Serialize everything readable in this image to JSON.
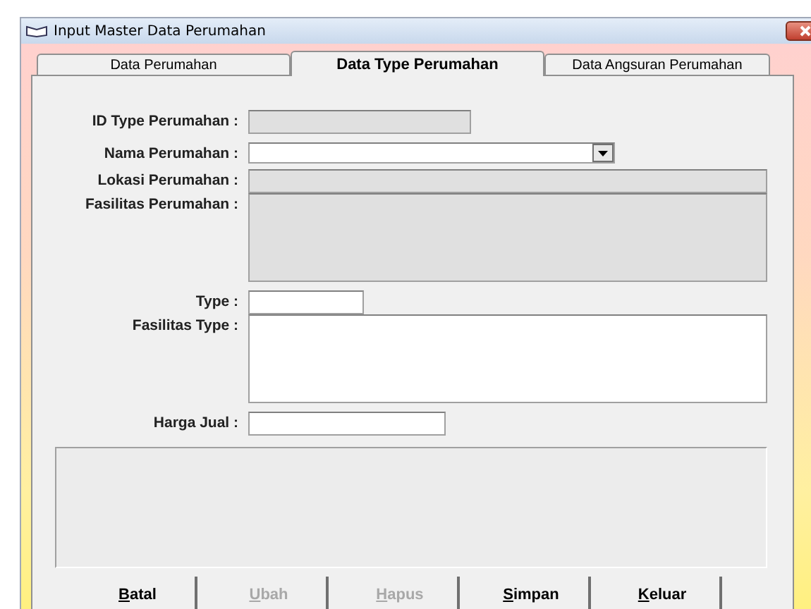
{
  "window": {
    "title": "Input Master Data Perumahan"
  },
  "tabs": [
    {
      "label": "Data Perumahan",
      "selected": false
    },
    {
      "label": "Data Type Perumahan",
      "selected": true
    },
    {
      "label": "Data Angsuran Perumahan",
      "selected": false
    }
  ],
  "fields": [
    {
      "label": "ID Type Perumahan :",
      "kind": "text",
      "disabled": true
    },
    {
      "label": "Nama Perumahan :",
      "kind": "combo",
      "disabled": false
    },
    {
      "label": "Lokasi Perumahan :",
      "kind": "text",
      "disabled": true
    },
    {
      "label": "Fasilitas Perumahan :",
      "kind": "textarea",
      "disabled": true
    },
    {
      "label": "Type :",
      "kind": "text",
      "disabled": false
    },
    {
      "label": "Fasilitas Type :",
      "kind": "textarea",
      "disabled": false
    },
    {
      "label": "Harga Jual :",
      "kind": "text",
      "disabled": false
    }
  ],
  "buttons": [
    {
      "label": "Batal",
      "access_key_underlined": true,
      "disabled": false
    },
    {
      "label": "Ubah",
      "access_key_underlined": true,
      "disabled": true
    },
    {
      "label": "Hapus",
      "access_key_underlined": true,
      "disabled": true
    },
    {
      "label": "Simpan",
      "access_key_underlined": true,
      "disabled": false
    },
    {
      "label": "Keluar",
      "access_key_underlined": true,
      "disabled": false
    }
  ]
}
